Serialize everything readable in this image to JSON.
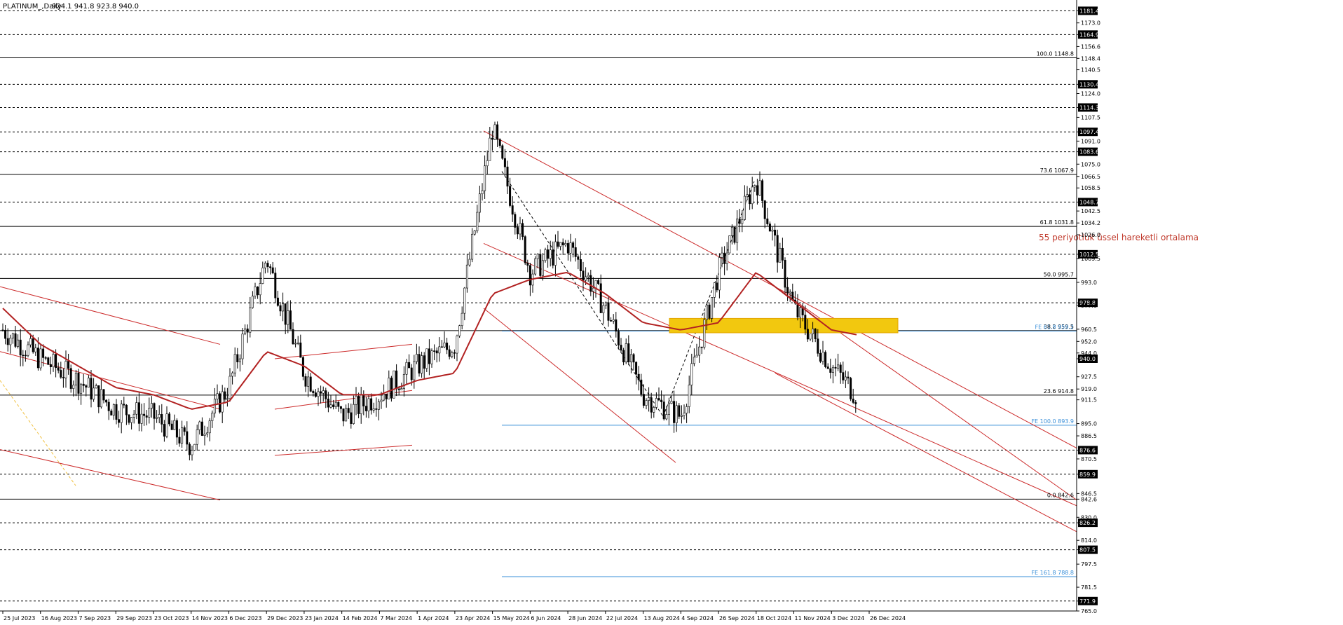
{
  "header": {
    "symbol_label": "PLATINUM_,Daily",
    "ohlc": "924.1 941.8 923.8 940.0"
  },
  "price_axis": {
    "ticks": [
      "1181.4",
      "1173.0",
      "1164.9",
      "1156.6",
      "1148.4",
      "1140.5",
      "1130.4",
      "1124.0",
      "1114.3",
      "1107.5",
      "1097.4",
      "1091.0",
      "1083.6",
      "1075.0",
      "1066.5",
      "1058.5",
      "1048.7",
      "1042.5",
      "1034.2",
      "1026.0",
      "1012.5",
      "1009.5",
      "993.0",
      "978.8",
      "977.0",
      "960.5",
      "952.0",
      "940.0",
      "944.0",
      "927.5",
      "919.0",
      "911.5",
      "895.0",
      "886.5",
      "876.6",
      "870.5",
      "859.9",
      "846.5",
      "842.6",
      "830.0",
      "826.2",
      "814.0",
      "807.5",
      "797.5",
      "781.5",
      "771.9",
      "765.0"
    ],
    "boxed": [
      "1181.4",
      "1164.9",
      "1130.4",
      "1114.3",
      "1097.4",
      "1083.6",
      "1048.7",
      "1012.5",
      "978.8",
      "940.0",
      "876.6",
      "859.9",
      "826.2",
      "807.5",
      "771.9"
    ]
  },
  "time_axis": {
    "labels": [
      "25 Jul 2023",
      "16 Aug 2023",
      "7 Sep 2023",
      "29 Sep 2023",
      "23 Oct 2023",
      "14 Nov 2023",
      "6 Dec 2023",
      "29 Dec 2023",
      "23 Jan 2024",
      "14 Feb 2024",
      "7 Mar 2024",
      "1 Apr 2024",
      "23 Apr 2024",
      "15 May 2024",
      "6 Jun 2024",
      "28 Jun 2024",
      "22 Jul 2024",
      "13 Aug 2024",
      "4 Sep 2024",
      "26 Sep 2024",
      "18 Oct 2024",
      "11 Nov 2024",
      "3 Dec 2024",
      "26 Dec 2024"
    ]
  },
  "fib_levels": [
    {
      "label": "100.0 1148.8",
      "price": 1148.8
    },
    {
      "label": "73.6 1067.9",
      "price": 1067.9
    },
    {
      "label": "61.8 1031.8",
      "price": 1031.8
    },
    {
      "label": "50.0 995.7",
      "price": 995.7
    },
    {
      "label": "38.2 959.5",
      "price": 959.5
    },
    {
      "label": "23.6 914.8",
      "price": 914.8
    },
    {
      "label": "0.0 842.6",
      "price": 842.6
    }
  ],
  "fe_levels": [
    {
      "label": "FE 61.8 959.2",
      "price": 959.2
    },
    {
      "label": "FE 100.0 893.9",
      "price": 893.9
    },
    {
      "label": "FE 161.8 788.8",
      "price": 788.8
    }
  ],
  "dashed_levels": [
    1181.4,
    1164.9,
    1130.4,
    1114.3,
    1097.4,
    1083.6,
    1048.7,
    1012.5,
    978.8,
    876.6,
    859.9,
    826.2,
    807.5,
    771.9
  ],
  "annotation": "55 periyotluk üssel hareketli ortalama",
  "current_price": "940.0",
  "chart_data": {
    "type": "candlestick",
    "title": "PLATINUM_,Daily",
    "series_name": "55 periyotluk üssel hareketli ortalama",
    "ylim": [
      765,
      1185
    ],
    "close_path": [
      [
        "25 Jul 2023",
        960
      ],
      [
        "16 Aug 2023",
        940
      ],
      [
        "7 Sep 2023",
        925
      ],
      [
        "29 Sep 2023",
        905
      ],
      [
        "23 Oct 2023",
        900
      ],
      [
        "14 Nov 2023",
        880
      ],
      [
        "6 Dec 2023",
        920
      ],
      [
        "29 Dec 2023",
        1010
      ],
      [
        "23 Jan 2024",
        930
      ],
      [
        "14 Feb 2024",
        900
      ],
      [
        "7 Mar 2024",
        915
      ],
      [
        "1 Apr 2024",
        935
      ],
      [
        "23 Apr 2024",
        950
      ],
      [
        "15 May 2024",
        1100
      ],
      [
        "6 Jun 2024",
        1000
      ],
      [
        "28 Jun 2024",
        1020
      ],
      [
        "22 Jul 2024",
        975
      ],
      [
        "13 Aug 2024",
        915
      ],
      [
        "4 Sep 2024",
        900
      ],
      [
        "26 Sep 2024",
        1000
      ],
      [
        "18 Oct 2024",
        1065
      ],
      [
        "11 Nov 2024",
        975
      ],
      [
        "3 Dec 2024",
        935
      ],
      [
        "26 Dec 2024",
        905
      ]
    ],
    "ema55_path": [
      [
        "25 Jul 2023",
        975
      ],
      [
        "16 Aug 2023",
        950
      ],
      [
        "7 Sep 2023",
        935
      ],
      [
        "29 Sep 2023",
        920
      ],
      [
        "23 Oct 2023",
        915
      ],
      [
        "14 Nov 2023",
        905
      ],
      [
        "6 Dec 2023",
        910
      ],
      [
        "29 Dec 2023",
        945
      ],
      [
        "23 Jan 2024",
        935
      ],
      [
        "14 Feb 2024",
        915
      ],
      [
        "7 Mar 2024",
        915
      ],
      [
        "1 Apr 2024",
        925
      ],
      [
        "23 Apr 2024",
        930
      ],
      [
        "15 May 2024",
        985
      ],
      [
        "6 Jun 2024",
        995
      ],
      [
        "28 Jun 2024",
        1000
      ],
      [
        "22 Jul 2024",
        985
      ],
      [
        "13 Aug 2024",
        965
      ],
      [
        "4 Sep 2024",
        960
      ],
      [
        "26 Sep 2024",
        965
      ],
      [
        "18 Oct 2024",
        1000
      ],
      [
        "11 Nov 2024",
        980
      ],
      [
        "3 Dec 2024",
        960
      ],
      [
        "26 Dec 2024",
        955
      ]
    ],
    "zone": {
      "from": 958,
      "to": 968,
      "color": "#f2c80f"
    }
  },
  "colors": {
    "candle": "#000000",
    "ema": "#b22222",
    "channel": "#cc2a2a",
    "fib": "#000000",
    "fe": "#3a8fd8",
    "zone": "#f2c80f",
    "zone_edge": "#e3a500"
  }
}
